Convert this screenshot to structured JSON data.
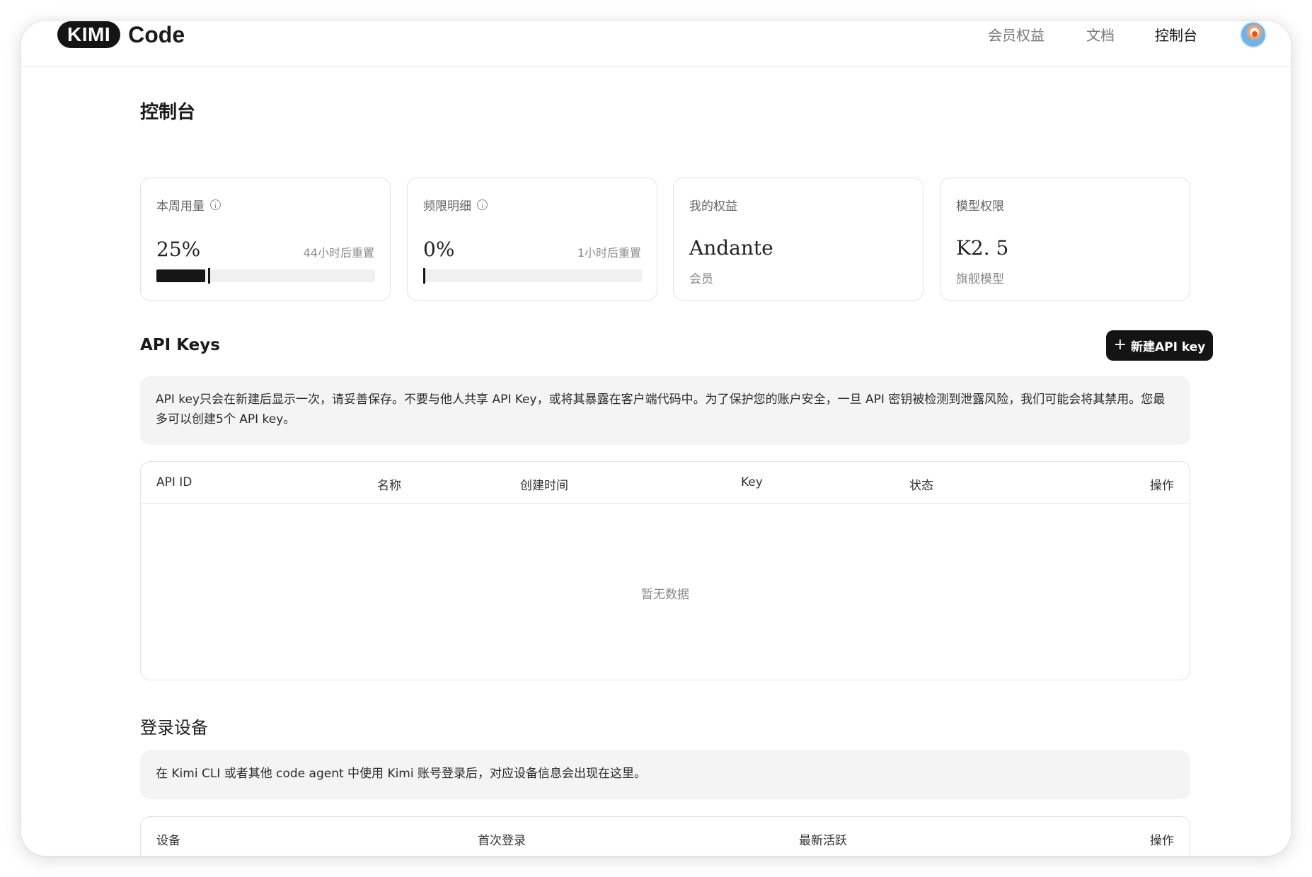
{
  "header": {
    "logo_text": "KIMI",
    "product_name": "Code",
    "nav": [
      {
        "label": "会员权益",
        "active": false
      },
      {
        "label": "文档",
        "active": false
      },
      {
        "label": "控制台",
        "active": true
      }
    ],
    "avatar_icon": "user-avatar"
  },
  "page": {
    "title": "控制台"
  },
  "cards": {
    "weekly_usage": {
      "label": "本周用量",
      "icon": "info-icon",
      "value": "25%",
      "progress": 0.25,
      "reset": "44小时后重置"
    },
    "rate_limit": {
      "label": "频限明细",
      "icon": "info-icon",
      "value": "0%",
      "progress": 0,
      "reset": "1小时后重置"
    },
    "benefits": {
      "label": "我的权益",
      "value": "Andante",
      "sub": "会员"
    },
    "model": {
      "label": "模型权限",
      "value": "K2. 5",
      "sub": "旗舰模型"
    }
  },
  "api_keys": {
    "title": "API Keys",
    "new_button": {
      "icon": "plus-icon",
      "label": "新建API key"
    },
    "notice": "API key只会在新建后显示一次，请妥善保存。不要与他人共享 API Key，或将其暴露在客户端代码中。为了保护您的账户安全，一旦 API 密钥被检测到泄露风险，我们可能会将其禁用。您最多可以创建5个 API key。",
    "columns": [
      "API ID",
      "名称",
      "创建时间",
      "Key",
      "状态",
      "操作"
    ],
    "empty_text": "暂无数据"
  },
  "devices": {
    "title": "登录设备",
    "notice": "在 Kimi CLI 或者其他 code agent 中使用 Kimi 账号登录后，对应设备信息会出现在这里。",
    "columns": [
      "设备",
      "首次登录",
      "最新活跃",
      "操作"
    ]
  },
  "colors": {
    "accent": "#141414",
    "notice_bg": "#f4f4f4",
    "border": "#e3e3e3"
  }
}
